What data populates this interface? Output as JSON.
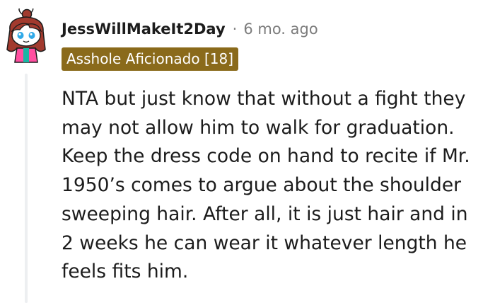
{
  "comment": {
    "author": "JessWillMakeIt2Day",
    "separator": "·",
    "time_ago": "6 mo. ago",
    "flair": "Asshole Aficionado [18]",
    "body_lines": [
      "NTA but just know that without a fight they",
      "may not allow him to walk for graduation.",
      "Keep the dress code on hand to recite if Mr.",
      "1950’s comes to argue about the shoulder",
      "sweeping hair. After all, it is just hair and in",
      "2 weeks he can wear it whatever length he",
      "feels fits him."
    ]
  },
  "colors": {
    "flair_background": "#8a6a1b",
    "flair_text": "#ffffff",
    "username": "#1c1c1c",
    "meta_gray": "#7c7c7c",
    "thread_line": "#edeff1",
    "avatar_hair": "#a23a2e",
    "avatar_shirt": "#ff4fa0"
  },
  "icons": {
    "avatar": "snoo-avatar-icon"
  }
}
